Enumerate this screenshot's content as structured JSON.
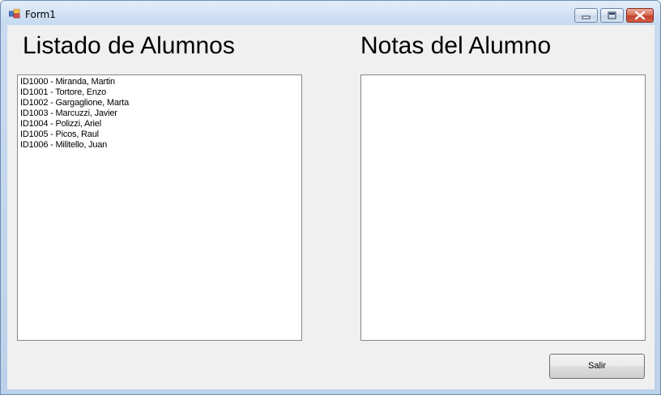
{
  "window": {
    "title": "Form1"
  },
  "left_panel": {
    "heading": "Listado de Alumnos",
    "items": [
      "ID1000 - Miranda, Martin",
      "ID1001 - Tortore, Enzo",
      "ID1002 - Gargaglione, Marta",
      "ID1003 - Marcuzzi, Javier",
      "ID1004 - Polizzi, Ariel",
      "ID1005 - Picos, Raul",
      "ID1006 - Militello, Juan"
    ]
  },
  "right_panel": {
    "heading": "Notas del Alumno",
    "items": []
  },
  "buttons": {
    "exit_label": "Salir"
  }
}
